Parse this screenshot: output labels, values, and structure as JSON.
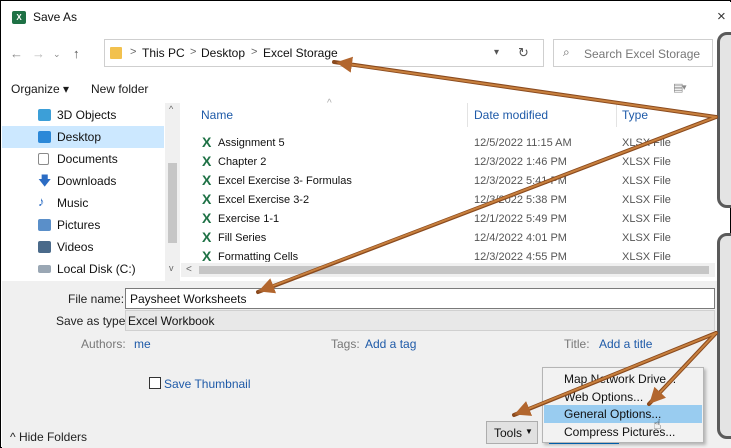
{
  "window": {
    "title": "Save As",
    "close": "×",
    "app_icon_letter": "X"
  },
  "address": {
    "crumbs": [
      "This PC",
      "Desktop",
      "Excel Storage"
    ],
    "separator": ">",
    "search_placeholder": "Search Excel Storage"
  },
  "toolbar": {
    "organize": "Organize ▾",
    "new_folder": "New folder"
  },
  "nav": {
    "items": [
      {
        "label": "3D Objects",
        "icon": "cube-icon",
        "color": "#3c9fd8"
      },
      {
        "label": "Desktop",
        "icon": "desktop-icon",
        "color": "#2b88d8",
        "selected": true
      },
      {
        "label": "Documents",
        "icon": "document-icon",
        "color": "#8a8a8a"
      },
      {
        "label": "Downloads",
        "icon": "download-icon",
        "color": "#2b6cc4"
      },
      {
        "label": "Music",
        "icon": "music-icon",
        "color": "#2b6cc4"
      },
      {
        "label": "Pictures",
        "icon": "pictures-icon",
        "color": "#5a8fc9"
      },
      {
        "label": "Videos",
        "icon": "videos-icon",
        "color": "#4a6a8a"
      },
      {
        "label": "Local Disk (C:)",
        "icon": "disk-icon",
        "color": "#7a8a9a"
      }
    ]
  },
  "files": {
    "columns": [
      "Name",
      "Date modified",
      "Type"
    ],
    "rows": [
      {
        "name": "Assignment 5",
        "date": "12/5/2022 11:15 AM",
        "type": "XLSX File"
      },
      {
        "name": "Chapter 2",
        "date": "12/3/2022 1:46 PM",
        "type": "XLSX File"
      },
      {
        "name": "Excel Exercise 3- Formulas",
        "date": "12/3/2022 5:41 PM",
        "type": "XLSX File"
      },
      {
        "name": "Excel Exercise 3-2",
        "date": "12/3/2022 5:38 PM",
        "type": "XLSX File"
      },
      {
        "name": "Exercise 1-1",
        "date": "12/1/2022 5:49 PM",
        "type": "XLSX File"
      },
      {
        "name": "Fill Series",
        "date": "12/4/2022 4:01 PM",
        "type": "XLSX File"
      },
      {
        "name": "Formatting Cells",
        "date": "12/3/2022 4:55 PM",
        "type": "XLSX File"
      }
    ]
  },
  "form": {
    "file_name_label": "File name:",
    "file_name_value": "Paysheet Worksheets",
    "save_type_label": "Save as type:",
    "save_type_value": "Excel Workbook",
    "authors_label": "Authors:",
    "authors_value": "me",
    "tags_label": "Tags:",
    "tags_value": "Add a tag",
    "title_label": "Title:",
    "title_value": "Add a title",
    "save_thumbnail": "Save Thumbnail",
    "hide_folders": "^ Hide Folders"
  },
  "tools": {
    "label": "Tools",
    "menu": [
      {
        "label": "Map Network Drive..."
      },
      {
        "label": "Web Options..."
      },
      {
        "label": "General Options...",
        "highlighted": true
      },
      {
        "label": "Compress Pictures..."
      }
    ]
  },
  "colors": {
    "accent": "#1e5aa8",
    "arrow": "#b2662e",
    "selection": "#cce8ff",
    "menu_highlight": "#99ccf0"
  }
}
